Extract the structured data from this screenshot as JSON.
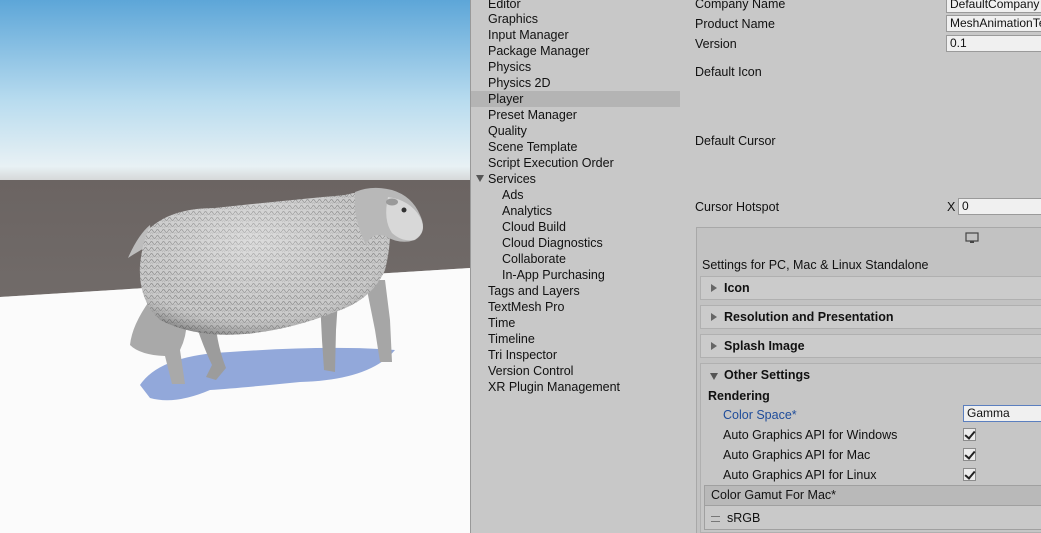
{
  "settings_list": {
    "items": [
      {
        "label": "Editor",
        "child": false
      },
      {
        "label": "Graphics",
        "child": false
      },
      {
        "label": "Input Manager",
        "child": false
      },
      {
        "label": "Package Manager",
        "child": false
      },
      {
        "label": "Physics",
        "child": false
      },
      {
        "label": "Physics 2D",
        "child": false
      },
      {
        "label": "Player",
        "child": false,
        "selected": true
      },
      {
        "label": "Preset Manager",
        "child": false
      },
      {
        "label": "Quality",
        "child": false
      },
      {
        "label": "Scene Template",
        "child": false
      },
      {
        "label": "Script Execution Order",
        "child": false
      },
      {
        "label": "Services",
        "child": false,
        "expanded": true
      },
      {
        "label": "Ads",
        "child": true
      },
      {
        "label": "Analytics",
        "child": true
      },
      {
        "label": "Cloud Build",
        "child": true
      },
      {
        "label": "Cloud Diagnostics",
        "child": true
      },
      {
        "label": "Collaborate",
        "child": true
      },
      {
        "label": "In-App Purchasing",
        "child": true
      },
      {
        "label": "Tags and Layers",
        "child": false
      },
      {
        "label": "TextMesh Pro",
        "child": false
      },
      {
        "label": "Time",
        "child": false
      },
      {
        "label": "Timeline",
        "child": false
      },
      {
        "label": "Tri Inspector",
        "child": false
      },
      {
        "label": "Version Control",
        "child": false
      },
      {
        "label": "XR Plugin Management",
        "child": false
      }
    ]
  },
  "inspector": {
    "company_name": {
      "label": "Company Name",
      "value": "DefaultCompany"
    },
    "product_name": {
      "label": "Product Name",
      "value": "MeshAnimationTest"
    },
    "version": {
      "label": "Version",
      "value": "0.1"
    },
    "default_icon_label": "Default Icon",
    "default_cursor_label": "Default Cursor",
    "cursor_hotspot": {
      "label": "Cursor Hotspot",
      "x_label": "X",
      "x_value": "0"
    },
    "platform_icon": "monitor-icon",
    "platform_title": "Settings for PC, Mac & Linux Standalone",
    "sections": {
      "icon": "Icon",
      "resolution": "Resolution and Presentation",
      "splash": "Splash Image",
      "other": "Other Settings"
    },
    "rendering": {
      "header": "Rendering",
      "color_space_label": "Color Space*",
      "color_space_value": "Gamma",
      "auto_windows": "Auto Graphics API  for Windows",
      "auto_mac": "Auto Graphics API  for Mac",
      "auto_linux": "Auto Graphics API  for Linux",
      "gamut_header": "Color Gamut For Mac*",
      "gamut_item": "sRGB"
    }
  },
  "colors": {
    "selected_row": "#b4b4b4",
    "panel": "#c8c8c8",
    "link_blue": "#1e4c9a"
  }
}
